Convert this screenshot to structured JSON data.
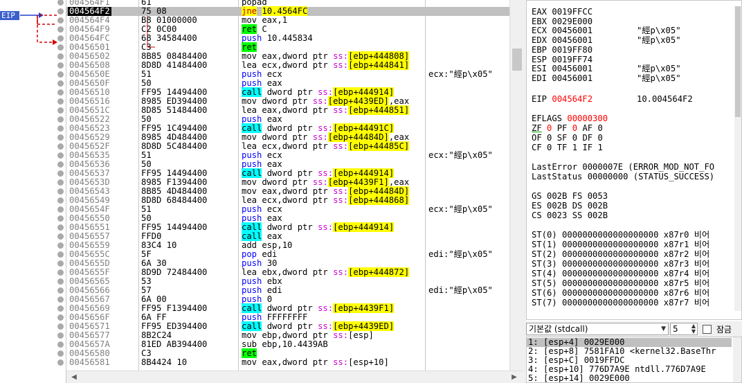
{
  "eip_tag": "EIP",
  "disasm": [
    {
      "addr": "004564F1",
      "bytes": "61",
      "ins": [
        [
          "popad",
          ""
        ]
      ],
      "com": ""
    },
    {
      "addr": "004564F2",
      "bytes": "75 08",
      "ins": [
        [
          "jne",
          "kw-jmp"
        ],
        [
          " ",
          ""
        ],
        [
          "10.4564FC",
          "hl"
        ]
      ],
      "com": "",
      "cur": true
    },
    {
      "addr": "004564F4",
      "bytes": "B8 01000000",
      "ins": [
        [
          "mov eax,1",
          ""
        ]
      ],
      "com": ""
    },
    {
      "addr": "004564F9",
      "bytes": "C2 0C00",
      "ins": [
        [
          "ret",
          "kw-ret"
        ],
        [
          " C",
          ""
        ]
      ],
      "com": ""
    },
    {
      "addr": "004564FC",
      "bytes": "68 34584400",
      "ins": [
        [
          "push",
          "kw-push"
        ],
        [
          " 10.445834",
          ""
        ]
      ],
      "com": ""
    },
    {
      "addr": "00456501",
      "bytes": "C3",
      "ins": [
        [
          "ret",
          "kw-ret"
        ]
      ],
      "com": ""
    },
    {
      "addr": "00456502",
      "bytes": "8B85 08484400",
      "ins": [
        [
          "mov eax,dword ptr ",
          ""
        ],
        [
          "ss:",
          "seg"
        ],
        [
          "[ebp+",
          "hl"
        ],
        [
          "444808",
          "hl"
        ],
        [
          "]",
          "hl"
        ]
      ],
      "com": ""
    },
    {
      "addr": "00456508",
      "bytes": "8D8D 41484400",
      "ins": [
        [
          "lea ecx,dword ptr ",
          ""
        ],
        [
          "ss:",
          "seg"
        ],
        [
          "[ebp+",
          "hl"
        ],
        [
          "444841",
          "hl"
        ],
        [
          "]",
          "hl"
        ]
      ],
      "com": ""
    },
    {
      "addr": "0045650E",
      "bytes": "51",
      "ins": [
        [
          "push",
          "kw-push"
        ],
        [
          " ecx",
          ""
        ]
      ],
      "com": "ecx:\"經p\\x05\""
    },
    {
      "addr": "0045650F",
      "bytes": "50",
      "ins": [
        [
          "push",
          "kw-push"
        ],
        [
          " eax",
          ""
        ]
      ],
      "com": ""
    },
    {
      "addr": "00456510",
      "bytes": "FF95 14494400",
      "ins": [
        [
          "call",
          "kw-call"
        ],
        [
          " dword ptr ",
          ""
        ],
        [
          "ss:",
          "seg"
        ],
        [
          "[ebp+",
          "hl"
        ],
        [
          "444914",
          "hl"
        ],
        [
          "]",
          "hl"
        ]
      ],
      "com": ""
    },
    {
      "addr": "00456516",
      "bytes": "8985 ED394400",
      "ins": [
        [
          "mov dword ptr ",
          ""
        ],
        [
          "ss:",
          "seg"
        ],
        [
          "[ebp+",
          "hl"
        ],
        [
          "4439ED",
          "hl"
        ],
        [
          "]",
          "hl"
        ],
        [
          ",eax",
          ""
        ]
      ],
      "com": ""
    },
    {
      "addr": "0045651C",
      "bytes": "8D85 51484400",
      "ins": [
        [
          "lea eax,dword ptr ",
          ""
        ],
        [
          "ss:",
          "seg"
        ],
        [
          "[ebp+",
          "hl"
        ],
        [
          "444851",
          "hl"
        ],
        [
          "]",
          "hl"
        ]
      ],
      "com": ""
    },
    {
      "addr": "00456522",
      "bytes": "50",
      "ins": [
        [
          "push",
          "kw-push"
        ],
        [
          " eax",
          ""
        ]
      ],
      "com": ""
    },
    {
      "addr": "00456523",
      "bytes": "FF95 1C494400",
      "ins": [
        [
          "call",
          "kw-call"
        ],
        [
          " dword ptr ",
          ""
        ],
        [
          "ss:",
          "seg"
        ],
        [
          "[ebp+",
          "hl"
        ],
        [
          "44491C",
          "hl"
        ],
        [
          "]",
          "hl"
        ]
      ],
      "com": ""
    },
    {
      "addr": "00456529",
      "bytes": "8985 4D484400",
      "ins": [
        [
          "mov dword ptr ",
          ""
        ],
        [
          "ss:",
          "seg"
        ],
        [
          "[ebp+",
          "hl"
        ],
        [
          "44484D",
          "hl"
        ],
        [
          "]",
          "hl"
        ],
        [
          ",eax",
          ""
        ]
      ],
      "com": ""
    },
    {
      "addr": "0045652F",
      "bytes": "8D8D 5C484400",
      "ins": [
        [
          "lea ecx,dword ptr ",
          ""
        ],
        [
          "ss:",
          "seg"
        ],
        [
          "[ebp+",
          "hl"
        ],
        [
          "44485C",
          "hl"
        ],
        [
          "]",
          "hl"
        ]
      ],
      "com": ""
    },
    {
      "addr": "00456535",
      "bytes": "51",
      "ins": [
        [
          "push",
          "kw-push"
        ],
        [
          " ecx",
          ""
        ]
      ],
      "com": "ecx:\"經p\\x05\""
    },
    {
      "addr": "00456536",
      "bytes": "50",
      "ins": [
        [
          "push",
          "kw-push"
        ],
        [
          " eax",
          ""
        ]
      ],
      "com": ""
    },
    {
      "addr": "00456537",
      "bytes": "FF95 14494400",
      "ins": [
        [
          "call",
          "kw-call"
        ],
        [
          " dword ptr ",
          ""
        ],
        [
          "ss:",
          "seg"
        ],
        [
          "[ebp+",
          "hl"
        ],
        [
          "444914",
          "hl"
        ],
        [
          "]",
          "hl"
        ]
      ],
      "com": ""
    },
    {
      "addr": "0045653D",
      "bytes": "8985 F1394400",
      "ins": [
        [
          "mov dword ptr ",
          ""
        ],
        [
          "ss:",
          "seg"
        ],
        [
          "[ebp+",
          "hl"
        ],
        [
          "4439F1",
          "hl"
        ],
        [
          "]",
          "hl"
        ],
        [
          ",eax",
          ""
        ]
      ],
      "com": ""
    },
    {
      "addr": "00456543",
      "bytes": "8B85 4D484400",
      "ins": [
        [
          "mov eax,dword ptr ",
          ""
        ],
        [
          "ss:",
          "seg"
        ],
        [
          "[ebp+",
          "hl"
        ],
        [
          "44484D",
          "hl"
        ],
        [
          "]",
          "hl"
        ]
      ],
      "com": ""
    },
    {
      "addr": "00456549",
      "bytes": "8D8D 68484400",
      "ins": [
        [
          "lea ecx,dword ptr ",
          ""
        ],
        [
          "ss:",
          "seg"
        ],
        [
          "[ebp+",
          "hl"
        ],
        [
          "444868",
          "hl"
        ],
        [
          "]",
          "hl"
        ]
      ],
      "com": ""
    },
    {
      "addr": "0045654F",
      "bytes": "51",
      "ins": [
        [
          "push",
          "kw-push"
        ],
        [
          " ecx",
          ""
        ]
      ],
      "com": "ecx:\"經p\\x05\""
    },
    {
      "addr": "00456550",
      "bytes": "50",
      "ins": [
        [
          "push",
          "kw-push"
        ],
        [
          " eax",
          ""
        ]
      ],
      "com": ""
    },
    {
      "addr": "00456551",
      "bytes": "FF95 14494400",
      "ins": [
        [
          "call",
          "kw-call"
        ],
        [
          " dword ptr ",
          ""
        ],
        [
          "ss:",
          "seg"
        ],
        [
          "[ebp+",
          "hl"
        ],
        [
          "444914",
          "hl"
        ],
        [
          "]",
          "hl"
        ]
      ],
      "com": ""
    },
    {
      "addr": "00456557",
      "bytes": "FFD0",
      "ins": [
        [
          "call",
          "kw-call"
        ],
        [
          " eax",
          ""
        ]
      ],
      "com": ""
    },
    {
      "addr": "00456559",
      "bytes": "83C4 10",
      "ins": [
        [
          "add esp,10",
          ""
        ]
      ],
      "com": ""
    },
    {
      "addr": "0045655C",
      "bytes": "5F",
      "ins": [
        [
          "pop",
          "kw-pop"
        ],
        [
          " edi",
          ""
        ]
      ],
      "com": "edi:\"經p\\x05\""
    },
    {
      "addr": "0045655D",
      "bytes": "6A 30",
      "ins": [
        [
          "push",
          "kw-push"
        ],
        [
          " 30",
          ""
        ]
      ],
      "com": ""
    },
    {
      "addr": "0045655F",
      "bytes": "8D9D 72484400",
      "ins": [
        [
          "lea ebx,dword ptr ",
          ""
        ],
        [
          "ss:",
          "seg"
        ],
        [
          "[ebp+",
          "hl"
        ],
        [
          "444872",
          "hl"
        ],
        [
          "]",
          "hl"
        ]
      ],
      "com": ""
    },
    {
      "addr": "00456565",
      "bytes": "53",
      "ins": [
        [
          "push",
          "kw-push"
        ],
        [
          " ebx",
          ""
        ]
      ],
      "com": ""
    },
    {
      "addr": "00456566",
      "bytes": "57",
      "ins": [
        [
          "push",
          "kw-push"
        ],
        [
          " edi",
          ""
        ]
      ],
      "com": "edi:\"經p\\x05\""
    },
    {
      "addr": "00456567",
      "bytes": "6A 00",
      "ins": [
        [
          "push",
          "kw-push"
        ],
        [
          " 0",
          ""
        ]
      ],
      "com": ""
    },
    {
      "addr": "00456569",
      "bytes": "FF95 F1394400",
      "ins": [
        [
          "call",
          "kw-call"
        ],
        [
          " dword ptr ",
          ""
        ],
        [
          "ss:",
          "seg"
        ],
        [
          "[ebp+",
          "hl"
        ],
        [
          "4439F1",
          "hl"
        ],
        [
          "]",
          "hl"
        ]
      ],
      "com": ""
    },
    {
      "addr": "0045656F",
      "bytes": "6A FF",
      "ins": [
        [
          "push",
          "kw-push"
        ],
        [
          " FFFFFFFF",
          ""
        ]
      ],
      "com": ""
    },
    {
      "addr": "00456571",
      "bytes": "FF95 ED394400",
      "ins": [
        [
          "call",
          "kw-call"
        ],
        [
          " dword ptr ",
          ""
        ],
        [
          "ss:",
          "seg"
        ],
        [
          "[ebp+",
          "hl"
        ],
        [
          "4439ED",
          "hl"
        ],
        [
          "]",
          "hl"
        ]
      ],
      "com": ""
    },
    {
      "addr": "00456577",
      "bytes": "8B2C24",
      "ins": [
        [
          "mov ebp,dword ptr ",
          ""
        ],
        [
          "ss:",
          "seg"
        ],
        [
          "[esp]",
          ""
        ]
      ],
      "com": ""
    },
    {
      "addr": "0045657A",
      "bytes": "81ED AB394400",
      "ins": [
        [
          "sub ebp,10.4439AB",
          ""
        ]
      ],
      "com": ""
    },
    {
      "addr": "00456580",
      "bytes": "C3",
      "ins": [
        [
          "ret",
          "kw-ret"
        ]
      ],
      "com": ""
    },
    {
      "addr": "00456581",
      "bytes": "8B4424 10",
      "ins": [
        [
          "mov eax,dword ptr ",
          ""
        ],
        [
          "ss:",
          "seg"
        ],
        [
          "[esp+10]",
          ""
        ]
      ],
      "com": ""
    }
  ],
  "registers": {
    "gp": [
      {
        "name": "EAX",
        "val": "0019FFCC",
        "com": ""
      },
      {
        "name": "EBX",
        "val": "0029E000",
        "com": ""
      },
      {
        "name": "ECX",
        "val": "00456001",
        "com": "\"經p\\x05\""
      },
      {
        "name": "EDX",
        "val": "00456001",
        "com": "\"經p\\x05\""
      },
      {
        "name": "EBP",
        "val": "0019FF80",
        "com": ""
      },
      {
        "name": "ESP",
        "val": "0019FF74",
        "com": ""
      },
      {
        "name": "ESI",
        "val": "00456001",
        "com": "\"經p\\x05\""
      },
      {
        "name": "EDI",
        "val": "00456001",
        "com": "\"經p\\x05\""
      }
    ],
    "eip": {
      "name": "EIP",
      "val": "004564F2",
      "com": "10.004564F2"
    },
    "eflags": {
      "name": "EFLAGS",
      "val": "00000300"
    },
    "flags": [
      [
        {
          "n": "ZF",
          "v": "0",
          "red": true
        },
        {
          "n": "PF",
          "v": "0",
          "red": true
        },
        {
          "n": "AF",
          "v": "0"
        }
      ],
      [
        {
          "n": "OF",
          "v": "0"
        },
        {
          "n": "SF",
          "v": "0"
        },
        {
          "n": "DF",
          "v": "0"
        }
      ],
      [
        {
          "n": "CF",
          "v": "0"
        },
        {
          "n": "TF",
          "v": "1"
        },
        {
          "n": "IF",
          "v": "1"
        }
      ]
    ],
    "last_error": "LastError  0000007E (ERROR_MOD_NOT_FO",
    "last_status": "LastStatus 00000000 (STATUS_SUCCESS)",
    "segs": [
      "GS 002B  FS 0053",
      "ES 002B  DS 002B",
      "CS 0023  SS 002B"
    ],
    "fpu": [
      "ST(0) 0000000000000000000 x87r0 비어",
      "ST(1) 0000000000000000000 x87r1 비어",
      "ST(2) 0000000000000000000 x87r2 비어",
      "ST(3) 0000000000000000000 x87r3 비어",
      "ST(4) 0000000000000000000 x87r4 비어",
      "ST(5) 0000000000000000000 x87r5 비어",
      "ST(6) 0000000000000000000 x87r6 비어",
      "ST(7) 0000000000000000000 x87r7 비어"
    ]
  },
  "callconv": {
    "selected": "기본값 (stdcall)",
    "count": "5",
    "lock_label": "잠금"
  },
  "stack": [
    "1: [esp+4]  0029E000",
    "2: [esp+8]  7581FA10 <kernel32.BaseThr",
    "3: [esp+C]  0019FFDC",
    "4: [esp+10] 776D7A9E ntdll.776D7A9E",
    "5: [esp+14] 0029E000"
  ],
  "colors": {
    "jcc": "#c00000",
    "call_bg": "#00ffff",
    "ret_bg": "#00ff00",
    "hl_bg": "#ffff00",
    "flag_red": "#ff0000",
    "eip_tag": "#3a5fcd"
  }
}
